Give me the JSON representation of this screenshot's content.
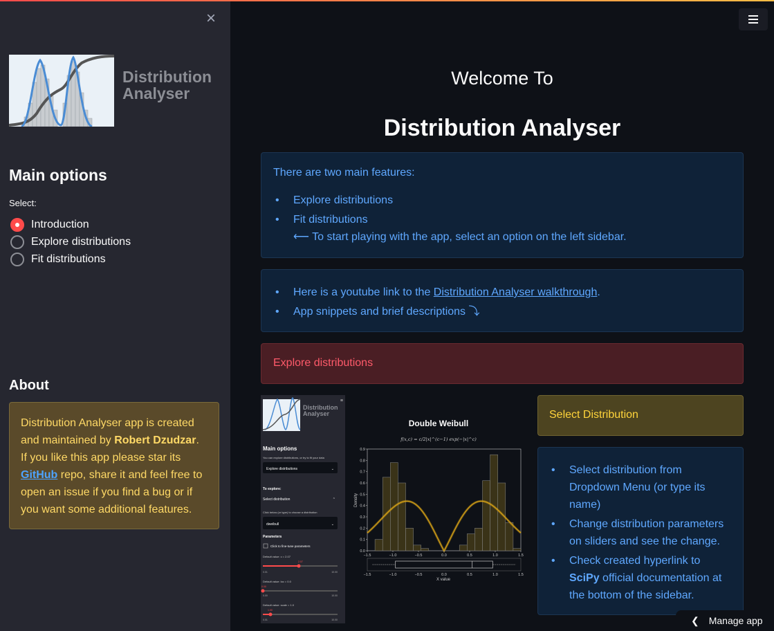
{
  "sidebar": {
    "close_icon": "×",
    "logo_title_line1": "Distribution",
    "logo_title_line2": "Analyser",
    "main_options_heading": "Main options",
    "select_label": "Select:",
    "radio_options": [
      {
        "label": "Introduction",
        "checked": true
      },
      {
        "label": "Explore distributions",
        "checked": false
      },
      {
        "label": "Fit distributions",
        "checked": false
      }
    ],
    "about_heading": "About",
    "about": {
      "text1": "Distribution Analyser app is created and maintained by ",
      "author": "Robert Dzudzar",
      "text2": ". If you like this app please star its ",
      "github_link": "GitHub",
      "text3": " repo, share it and feel free to open an issue if you find a bug or if you want some additional features."
    }
  },
  "header": {
    "menu_icon": "hamburger-icon"
  },
  "main": {
    "welcome": "Welcome To",
    "title": "Distribution Analyser",
    "features_box": {
      "intro": "There are two main features:",
      "items": [
        "Explore distributions",
        "Fit distributions"
      ],
      "hint": "⟵ To start playing with the app, select an option on the left sidebar."
    },
    "links_box": {
      "item1_prefix": "Here is a youtube link to the ",
      "item1_link": "Distribution Analyser walkthrough",
      "item1_suffix": ".",
      "item2": "App snippets and brief descriptions ⤵"
    },
    "explore_header": "Explore distributions",
    "select_distribution_header": "Select Distribution",
    "instructions": {
      "item1": "Select distribution from Dropdown Menu (or type its name)",
      "item2": "Change distribution parameters on sliders and see the change.",
      "item3_prefix": "Check created hyperlink to ",
      "item3_bold": "SciPy",
      "item3_suffix": " official documentation at the bottom of the sidebar."
    }
  },
  "snapshot": {
    "sidebar": {
      "logo_line1": "Distribution",
      "logo_line2": "Analyser",
      "main_options": "Main options",
      "explore_hint": "You can explore distributions, or try to fit your data",
      "select_value": "Explore distributions",
      "to_explore": "To explore:",
      "select_distribution": "Select distribution",
      "choose_hint": "Click below (or type) to choose a distribution",
      "distribution_value": "dweibull",
      "parameters": "Parameters",
      "fine_tune": "Click to fine-tune parameters",
      "slider1_label": "Default value: c = 2.07",
      "slider1_value": "2.07",
      "slider1_min": "0.01",
      "slider1_max": "10.00",
      "slider2_label": "Default value: loc = 0.0",
      "slider2_value": "0.00",
      "slider2_min": "0.00",
      "slider2_max": "10.00",
      "slider3_label": "Default value: scale = 1.0",
      "slider3_value": "1.00",
      "slider3_min": "0.01",
      "slider3_max": "10.00"
    },
    "plot": {
      "title": "Double Weibull",
      "formula": "f(x,c) = c/2|x|^(c−1) exp(−|x|^c)",
      "ylabel": "Density",
      "xlabel": "X value"
    }
  },
  "chart_data": {
    "type": "bar",
    "title": "Double Weibull",
    "xlabel": "X value",
    "ylabel": "Density",
    "xlim": [
      -1.5,
      1.5
    ],
    "ylim": [
      0,
      0.9
    ],
    "x_ticks": [
      "−1.5",
      "−1.0",
      "−0.5",
      "0.0",
      "0.5",
      "1.0",
      "1.5"
    ],
    "y_ticks": [
      "0.0",
      "0.1",
      "0.2",
      "0.3",
      "0.4",
      "0.5",
      "0.6",
      "0.7",
      "0.8",
      "0.9"
    ],
    "histogram": {
      "bin_edges": [
        -1.5,
        -1.35,
        -1.2,
        -1.05,
        -0.9,
        -0.75,
        -0.6,
        -0.45,
        -0.3,
        -0.15,
        0.0,
        0.15,
        0.3,
        0.45,
        0.6,
        0.75,
        0.9,
        1.05,
        1.2,
        1.35,
        1.5
      ],
      "counts": [
        0.0,
        0.1,
        0.65,
        0.78,
        0.6,
        0.2,
        0.05,
        0.02,
        0.0,
        0.0,
        0.0,
        0.0,
        0.05,
        0.15,
        0.2,
        0.62,
        0.85,
        0.6,
        0.25,
        0.02
      ]
    },
    "curve_color": "#d4a017"
  },
  "colors": {
    "accent": "#ff4b4b",
    "info_text": "#5fa8ff",
    "warning_text": "#ffd43b",
    "error_text": "#ff5a6a"
  },
  "footer": {
    "manage_app": "Manage app"
  }
}
